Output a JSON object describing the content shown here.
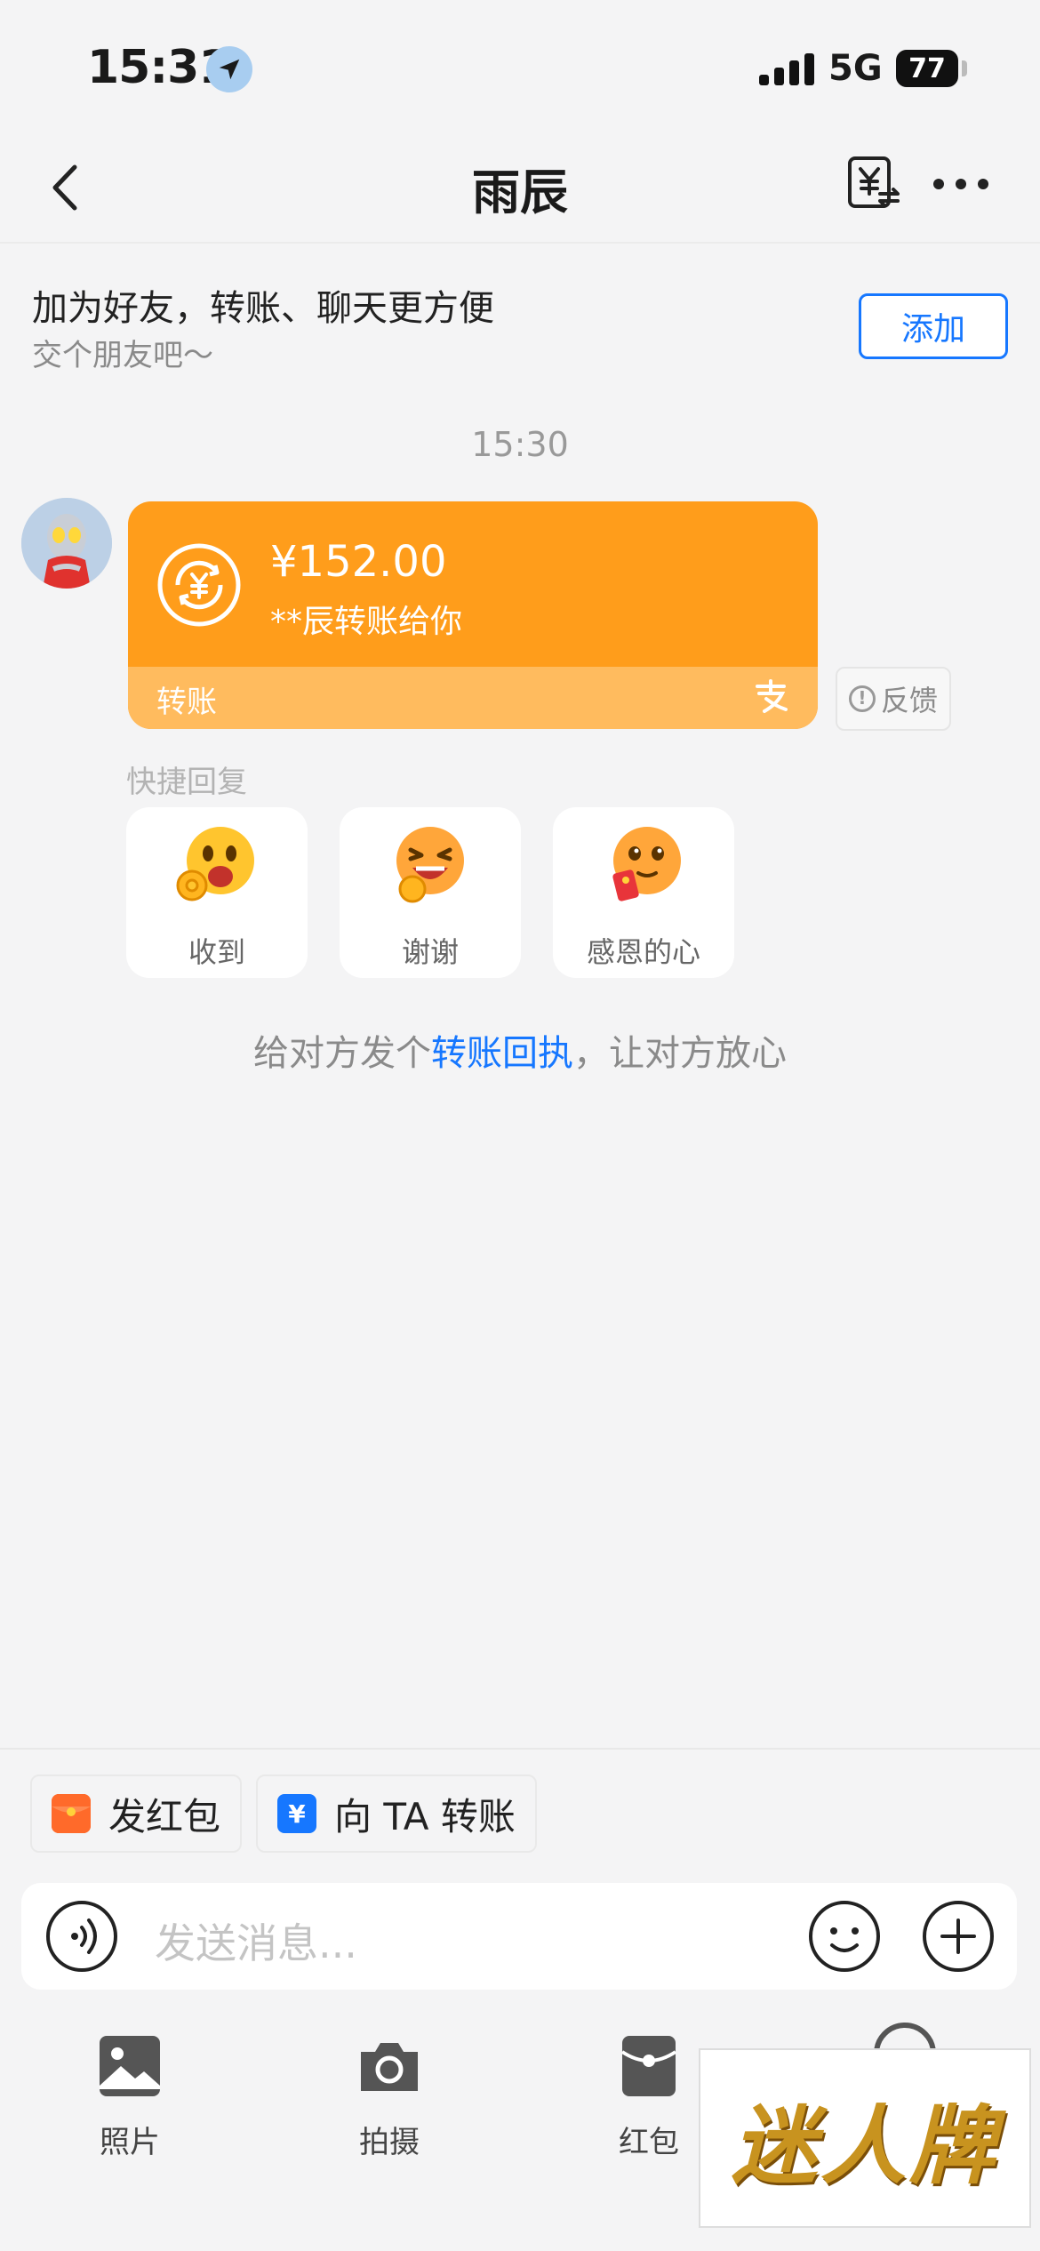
{
  "status_bar": {
    "time": "15:31",
    "network": "5G",
    "battery": "77"
  },
  "nav": {
    "title": "雨辰"
  },
  "friend_banner": {
    "title": "加为好友，转账、聊天更方便",
    "subtitle": "交个朋友吧～",
    "add_label": "添加"
  },
  "chat": {
    "time": "15:30",
    "transfer": {
      "amount": "¥152.00",
      "description": "**辰转账给你",
      "label": "转账"
    },
    "feedback_label": "反馈",
    "quick_reply_title": "快捷回复",
    "quick_replies": [
      {
        "label": "收到",
        "icon": "ok-hand-emoji"
      },
      {
        "label": "谢谢",
        "icon": "thanks-emoji"
      },
      {
        "label": "感恩的心",
        "icon": "grateful-emoji"
      }
    ],
    "receipt_tip": {
      "before": "给对方发个",
      "link": "转账回执",
      "after": "，让对方放心"
    }
  },
  "shortcuts": [
    {
      "label": "发红包",
      "icon": "red-envelope-icon",
      "color": "#ff6a2a"
    },
    {
      "label": "向 TA 转账",
      "icon": "yuan-transfer-icon",
      "color": "#1677ff"
    }
  ],
  "input": {
    "placeholder": "发送消息..."
  },
  "tools": [
    {
      "label": "照片",
      "icon": "photo-icon"
    },
    {
      "label": "拍摄",
      "icon": "camera-icon"
    },
    {
      "label": "红包",
      "icon": "red-envelope-icon"
    }
  ],
  "watermark": "迷人牌",
  "colors": {
    "accent": "#1677ff",
    "transfer_card": "#ff9d1b",
    "transfer_card_footer": "#ffbb5e",
    "background": "#f4f4f5"
  }
}
